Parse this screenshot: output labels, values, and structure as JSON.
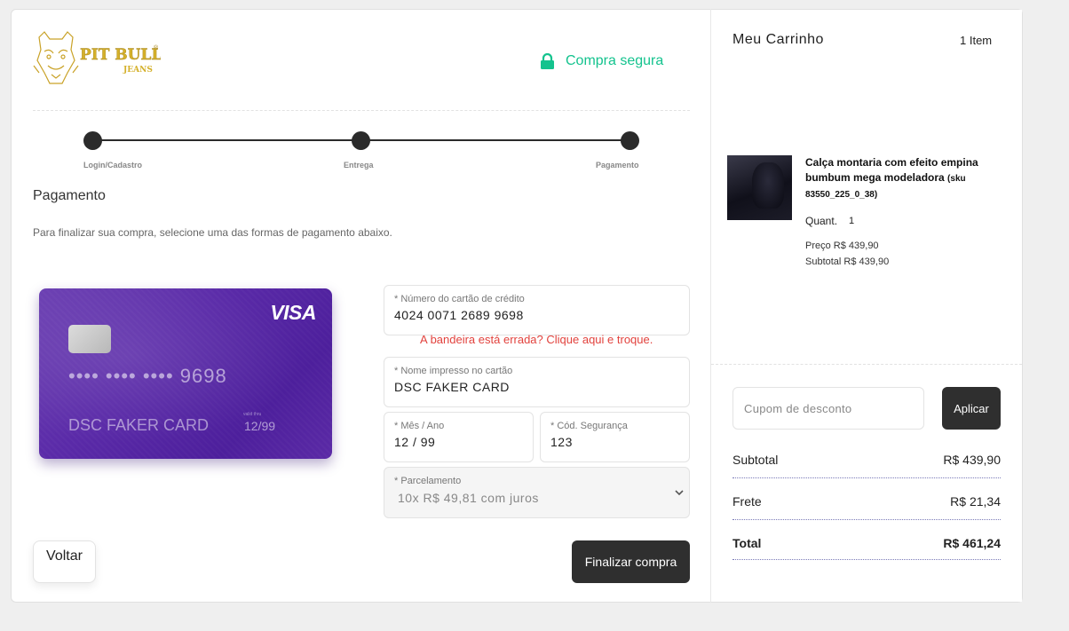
{
  "header": {
    "secure_label": "Compra segura",
    "logo_text": "PIT BULL",
    "logo_sub": "JEANS"
  },
  "steps": [
    {
      "label": "Login/Cadastro"
    },
    {
      "label": "Entrega"
    },
    {
      "label": "Pagamento"
    }
  ],
  "page": {
    "title": "Pagamento",
    "subtitle": "Para finalizar sua compra, selecione uma das formas de pagamento abaixo."
  },
  "card_preview": {
    "brand": "VISA",
    "number_masked": "•••• •••• •••• 9698",
    "name": "DSC FAKER CARD",
    "valid_label": "valid thru",
    "expiry": "12/99"
  },
  "form": {
    "card_number": {
      "label": "* Número do cartão de crédito",
      "value": "4024 0071 2689 9698"
    },
    "error": "A bandeira está errada? Clique aqui e troque.",
    "card_name": {
      "label": "* Nome impresso no cartão",
      "value": "DSC FAKER CARD"
    },
    "expiry": {
      "label": "* Mês / Ano",
      "value": "12 / 99"
    },
    "cvv": {
      "label": "* Cód. Segurança",
      "value": "123"
    },
    "installments": {
      "label": "* Parcelamento",
      "value": "10x R$ 49,81 com juros"
    }
  },
  "actions": {
    "back": "Voltar",
    "finish": "Finalizar compra"
  },
  "cart": {
    "title": "Meu Carrinho",
    "count": "1 Item",
    "product": {
      "name": "Calça montaria com efeito empina bumbum mega modeladora",
      "sku": "(sku 83550_225_0_38)",
      "qty_label": "Quant.",
      "qty": "1",
      "price": "Preço R$ 439,90",
      "subtotal": "Subtotal R$ 439,90"
    },
    "coupon_placeholder": "Cupom de desconto",
    "apply_label": "Aplicar",
    "summary": {
      "subtotal_label": "Subtotal",
      "subtotal_value": "R$ 439,90",
      "shipping_label": "Frete",
      "shipping_value": "R$ 21,34",
      "total_label": "Total",
      "total_value": "R$ 461,24"
    }
  },
  "colors": {
    "accent_green": "#14c38e",
    "error_red": "#e2423d",
    "card_purple": "#5a2aa8",
    "button_dark": "#2f2f2f"
  }
}
